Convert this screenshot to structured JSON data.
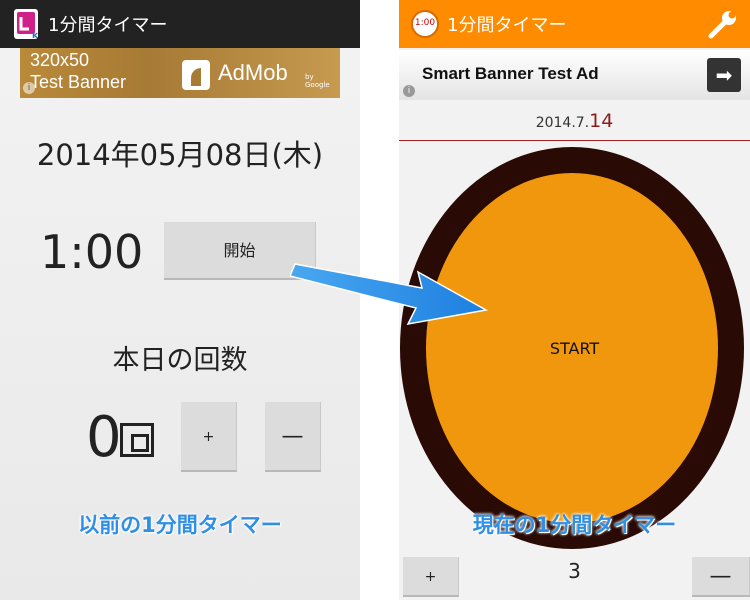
{
  "left": {
    "app_title": "1分間タイマー",
    "ad": {
      "line1": "320x50",
      "line2": "Test Banner",
      "brand": "AdMob",
      "brand_sub": "by Google",
      "info": "i"
    },
    "date": "2014年05月08日(木)",
    "timer": "1:00",
    "start_label": "開始",
    "today_label": "本日の回数",
    "count": "0",
    "plus_label": "+",
    "minus_label": "—",
    "caption": "以前の1分間タイマー"
  },
  "right": {
    "badge": "1:00",
    "app_title": "1分間タイマー",
    "ad": {
      "text": "Smart Banner Test Ad",
      "button": "➡",
      "info": "i"
    },
    "date_prefix": "2014.7.",
    "date_day": "14",
    "start_label": "START",
    "caption": "現在の1分間タイマー",
    "plus_label": "+",
    "count": "3",
    "minus_label": "—"
  },
  "colors": {
    "orange_bar": "#ff8c00",
    "circle": "#f0970e",
    "circle_border": "#2a0a05",
    "caption_blue": "#2f8fe6",
    "arrow_blue": "#2e8ee6"
  }
}
